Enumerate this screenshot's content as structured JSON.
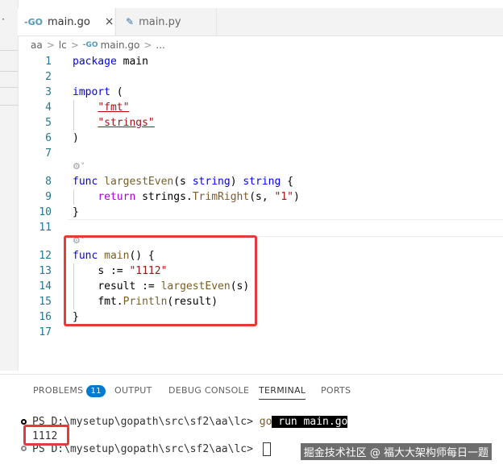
{
  "sidebar": {
    "dots": "·"
  },
  "tabs": [
    {
      "label": "main.go",
      "icon": "go-file-icon",
      "close": "×"
    },
    {
      "label": "main.py",
      "icon": "python-file-icon"
    }
  ],
  "breadcrumb": [
    "aa",
    "lc",
    "main.go",
    "..."
  ],
  "editor": {
    "line_numbers": [
      "1",
      "2",
      "3",
      "4",
      "5",
      "6",
      "7",
      "8",
      "9",
      "10",
      "11",
      "12",
      "13",
      "14",
      "15",
      "16",
      "17"
    ],
    "code": {
      "l1_kw": "package",
      "l1_rest": " main",
      "l3_kw": "import",
      "l3_rest": " (",
      "l4": "\"fmt\"",
      "l5": "\"strings\"",
      "l6": ")",
      "l8_kw": "func",
      "l8_fn": " largestEven",
      "l8_p1": "(s ",
      "l8_t1": "string",
      "l8_p2": ") ",
      "l8_t2": "string",
      "l8_p3": " {",
      "l9_kw": "return",
      "l9_pkg": " strings.",
      "l9_fn": "TrimRight",
      "l9_p": "(s, ",
      "l9_str": "\"1\"",
      "l9_end": ")",
      "l10": "}",
      "l12_kw": "func",
      "l12_fn": " main",
      "l12_rest": "() {",
      "l13_a": "s := ",
      "l13_str": "\"1112\"",
      "l14_a": "result := ",
      "l14_fn": "largestEven",
      "l14_b": "(s)",
      "l15_a": "fmt.",
      "l15_fn": "Println",
      "l15_b": "(result)",
      "l16": "}"
    },
    "codelens": "⚙˅"
  },
  "panel": {
    "tabs": [
      "PROBLEMS",
      "OUTPUT",
      "DEBUG CONSOLE",
      "TERMINAL",
      "PORTS"
    ],
    "problems_count": "11",
    "active_tab": "TERMINAL"
  },
  "terminal": {
    "prompt1": "PS D:\\mysetup\\gopath\\src\\sf2\\aa\\lc> ",
    "cmd_go": "go",
    "cmd_rest": " run main.go",
    "output": "1112",
    "prompt2": "PS D:\\mysetup\\gopath\\src\\sf2\\aa\\lc> "
  },
  "watermark": "掘金技术社区 @ 福大大架构师每日一题",
  "colors": {
    "accent": "#007acc",
    "highlight": "#e33a3a"
  }
}
